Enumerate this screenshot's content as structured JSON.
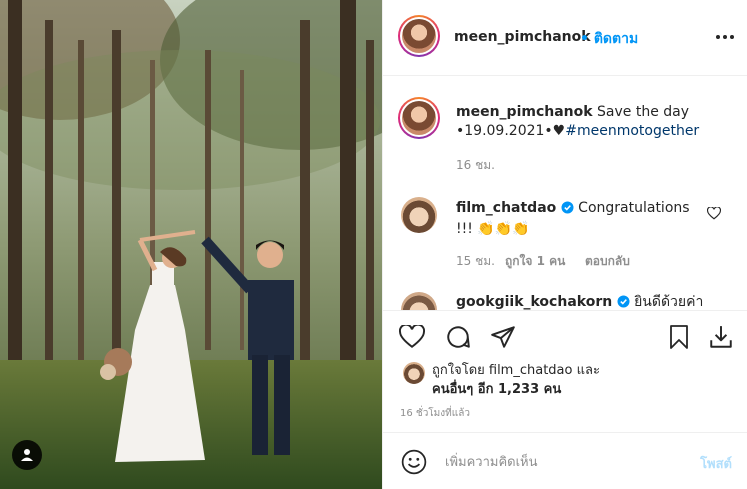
{
  "post": {
    "author": "meen_pimchanok",
    "follow_label": "• ติดตาม",
    "more_icon": "more-horizontal-icon",
    "caption_text": "Save the day",
    "caption_line2": "•19.09.2021•♥",
    "caption_hashtag": "#meenmotogether",
    "caption_time": "16 ชม."
  },
  "comments": [
    {
      "author": "film_chatdao",
      "verified": true,
      "text": "Congratulations",
      "text_line2": "!!! 👏👏👏",
      "time": "15 ชม.",
      "likes": "ถูกใจ 1 คน",
      "reply_label": "ตอบกลับ"
    },
    {
      "author": "gookgiik_kochakorn",
      "verified": true,
      "text": "ยินดีด้วยค่า"
    }
  ],
  "likes": {
    "line1": "ถูกใจโดย film_chatdao และ",
    "line2": "คนอื่นๆ อีก 1,233 คน",
    "posted_ago": "16 ชั่วโมงที่แล้ว"
  },
  "add_comment": {
    "placeholder": "เพิ่มความคิดเห็น",
    "post_label": "โพสต์"
  },
  "colors": {
    "accent": "#0095f6",
    "text": "#262626",
    "muted": "#8e8e8e",
    "post_disabled": "#b2dffc"
  }
}
